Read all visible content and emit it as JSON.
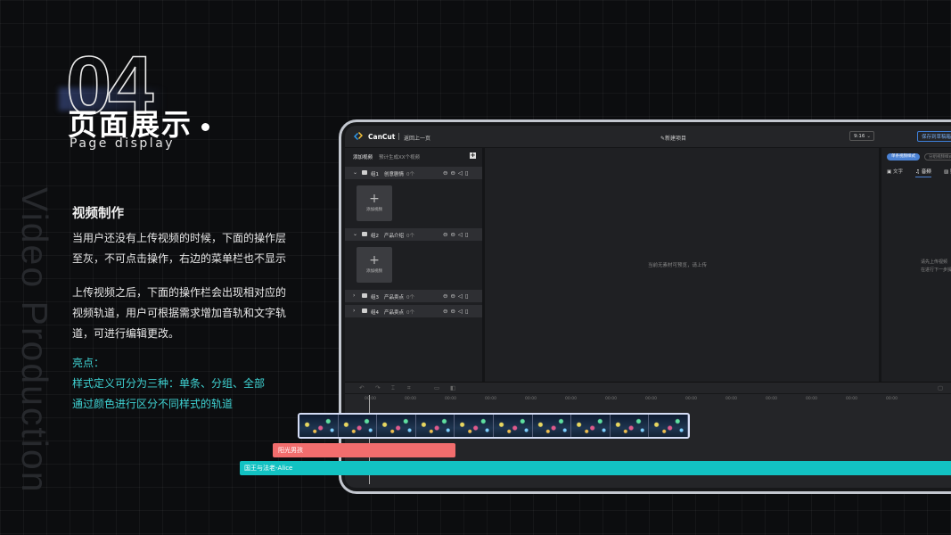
{
  "slide": {
    "number": "04",
    "title_cn": "页面展示",
    "title_en": "Page display",
    "vertical_text": "Video Production",
    "section_title": "视频制作",
    "paragraph1": "当用户还没有上传视频的时候，下面的操作层至灰，不可点击操作，右边的菜单栏也不显示",
    "paragraph2": "上传视频之后，下面的操作栏会出现相对应的视频轨道，用户可根据需求增加音轨和文字轨道，可进行编辑更改。",
    "highlight_label": "亮点：",
    "highlight_line1": "样式定义可分为三种：单条、分组、全部",
    "highlight_line2": "通过颜色进行区分不同样式的轨道",
    "colors": {
      "highlight": "#3fd3d3",
      "audio_track": "#f26d6d",
      "text_track": "#12c2c2",
      "accent": "#4b82d4"
    }
  },
  "app": {
    "name": "CanCut",
    "back_label": "返回上一页",
    "new_project": "新建项目",
    "ratio": "9:16",
    "save_label": "保存到草稿箱",
    "left_panel": {
      "add_label": "添加视频",
      "count_label": "预计生成XX个视频",
      "add_box_label": "添加视频",
      "groups": [
        {
          "name": "组1",
          "title": "创意剧情",
          "count": "0个"
        },
        {
          "name": "组2",
          "title": "产品介绍",
          "count": "0个"
        },
        {
          "name": "组3",
          "title": "产品卖点",
          "count": "0个"
        },
        {
          "name": "组4",
          "title": "产品卖点",
          "count": "0个"
        }
      ]
    },
    "center_message": "当前无素材可预览，请上传",
    "right_panel": {
      "mode_active": "单条视频样式",
      "mode_inactive": "分组视频样式",
      "tabs": [
        "文字",
        "音频",
        "贴"
      ],
      "message_line1": "请先上传视频",
      "message_line2": "在进行下一步操"
    },
    "timeline": {
      "ruler": [
        "00:00",
        "00:00",
        "00:00",
        "00:00",
        "00:00",
        "00:00",
        "00:00",
        "00:00",
        "00:00",
        "00:00",
        "00:00",
        "00:00",
        "00:00",
        "00:00"
      ],
      "audio_track_label": "阳光男孩",
      "text_track_label": "国王与法老-Alice"
    }
  }
}
